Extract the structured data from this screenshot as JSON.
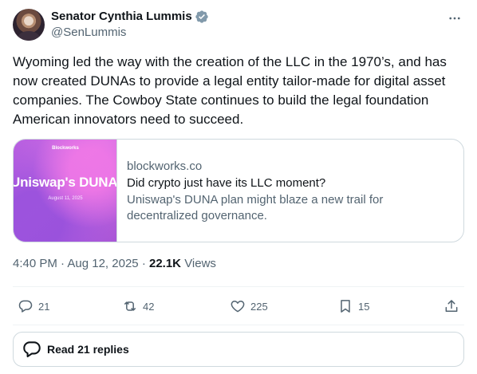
{
  "author": {
    "name": "Senator Cynthia Lummis",
    "handle": "@SenLummis",
    "verified_badge_icon": "verified-badge-icon",
    "badge_color": "#829aab"
  },
  "tweet": {
    "text": "Wyoming led the way with the creation of the LLC in the 1970’s, and has now created DUNAs to provide a legal entity tailor-made for digital asset companies. The Cowboy State continues to build the legal foundation American innovators need to succeed."
  },
  "card": {
    "thumbnail": {
      "logo_text": "Blockworks",
      "title_text": "Uniswap's DUNA pl",
      "date_text": "August 11, 2025"
    },
    "domain": "blockworks.co",
    "title": "Did crypto just have its LLC moment?",
    "description": "Uniswap's DUNA plan might blaze a new trail for decentralized governance."
  },
  "meta": {
    "time": "4:40 PM",
    "separator": "·",
    "date": "Aug 12, 2025",
    "views_count": "22.1K",
    "views_label": "Views"
  },
  "actions": {
    "replies": "21",
    "reposts": "42",
    "likes": "225",
    "bookmarks": "15"
  },
  "read_replies": {
    "label": "Read 21 replies"
  },
  "colors": {
    "text_primary": "#0f1419",
    "text_secondary": "#536471",
    "border": "#cfd9de"
  }
}
